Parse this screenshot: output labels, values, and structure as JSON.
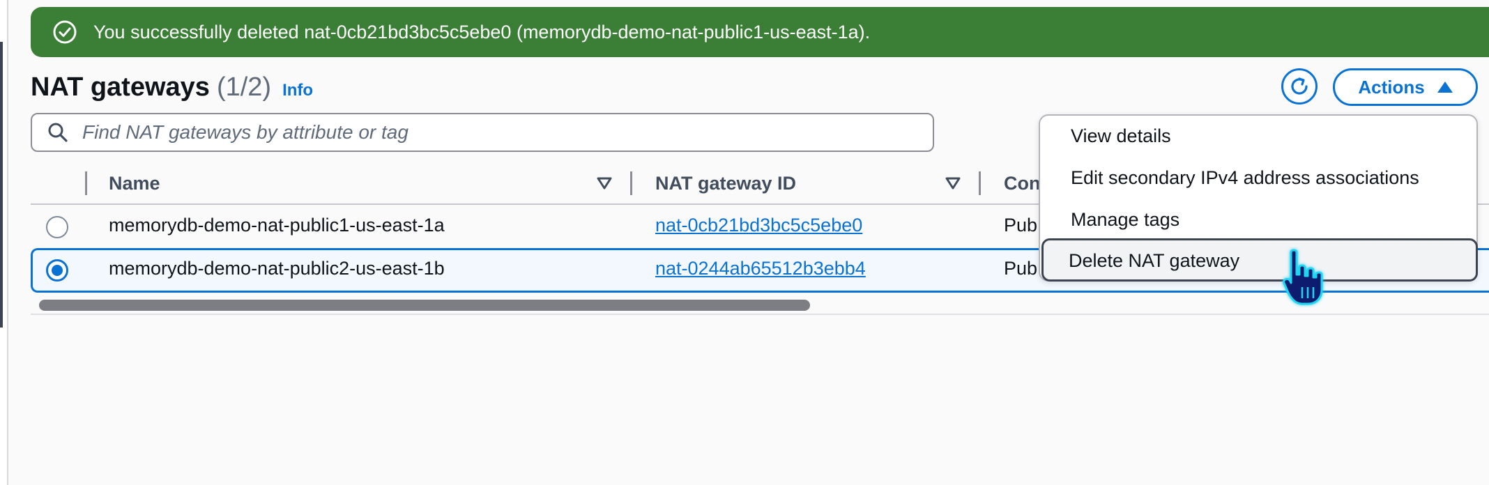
{
  "flash": {
    "message": "You successfully deleted nat-0cb21bd3bc5c5ebe0 (memorydb-demo-nat-public1-us-east-1a).",
    "icon": "check-circle-icon",
    "color": "#3a7f35"
  },
  "header": {
    "title": "NAT gateways",
    "count": "(1/2)",
    "info_label": "Info"
  },
  "toolbar": {
    "refresh_icon": "refresh-icon",
    "actions_label": "Actions"
  },
  "search": {
    "placeholder": "Find NAT gateways by attribute or tag",
    "value": ""
  },
  "table": {
    "columns": [
      {
        "label": "Name"
      },
      {
        "label": "NAT gateway ID"
      },
      {
        "label": "Con"
      }
    ],
    "rows": [
      {
        "selected": false,
        "name": "memorydb-demo-nat-public1-us-east-1a",
        "id": "nat-0cb21bd3bc5c5ebe0",
        "connectivity": "Pub"
      },
      {
        "selected": true,
        "name": "memorydb-demo-nat-public2-us-east-1b",
        "id": "nat-0244ab65512b3ebb4",
        "connectivity": "Pub"
      }
    ]
  },
  "actions_menu": {
    "items": [
      {
        "label": "View details"
      },
      {
        "label": "Edit secondary IPv4 address associations"
      },
      {
        "label": "Manage tags"
      },
      {
        "label": "Delete NAT gateway",
        "highlighted": true
      }
    ]
  },
  "colors": {
    "accent": "#0972d3",
    "selected_row_bg": "#f2f8fd"
  }
}
